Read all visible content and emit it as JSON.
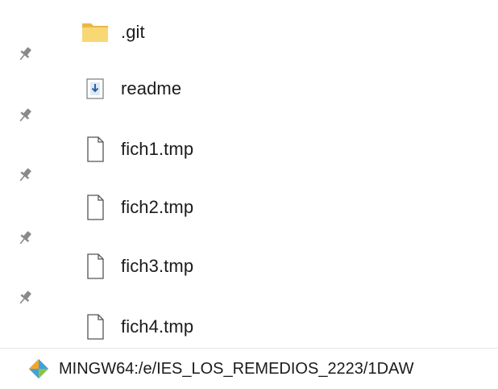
{
  "files": [
    {
      "name": ".git",
      "icon": "folder-icon"
    },
    {
      "name": "readme",
      "icon": "text-document-icon"
    },
    {
      "name": "fich1.tmp",
      "icon": "file-icon"
    },
    {
      "name": "fich2.tmp",
      "icon": "file-icon"
    },
    {
      "name": "fich3.tmp",
      "icon": "file-icon"
    },
    {
      "name": "fich4.tmp",
      "icon": "file-icon"
    }
  ],
  "pins": [
    "pin-icon",
    "pin-icon",
    "pin-icon",
    "pin-icon",
    "pin-icon"
  ],
  "taskbar": {
    "title": "MINGW64:/e/IES_LOS_REMEDIOS_2223/1DAW",
    "icon": "git-bash-icon"
  },
  "colors": {
    "folder": "#f8d775",
    "pin": "#8a8a8a",
    "text": "#1b1b1b"
  }
}
